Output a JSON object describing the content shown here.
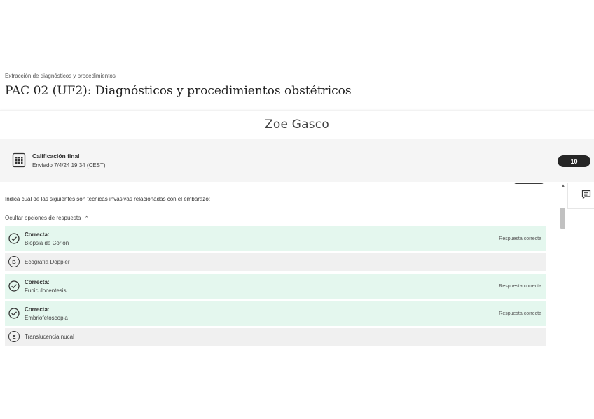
{
  "header": {
    "breadcrumb": "Extracción de diagnósticos y procedimientos",
    "title": "PAC 02 (UF2): Diagnósticos y procedimientos obstétricos"
  },
  "student": {
    "name": "Zoe Gasco"
  },
  "grade": {
    "label": "Calificación final",
    "submitted": "Enviado 7/4/24 19:34 (CEST)",
    "score": "10"
  },
  "question": {
    "text": "Indica cuál de las siguientes son técnicas invasivas relacionadas con el embarazo:",
    "toggle_label": "Ocultar opciones de respuesta",
    "answers": [
      {
        "status": "Correcta:",
        "text": "Biopsia de Corión",
        "note": "Respuesta correcta"
      },
      {
        "letter": "B",
        "text": "Ecografía Doppler"
      },
      {
        "status": "Correcta:",
        "text": "Funiculocentesis",
        "note": "Respuesta correcta"
      },
      {
        "status": "Correcta:",
        "text": "Embriofetoscopia",
        "note": "Respuesta correcta"
      },
      {
        "letter": "E",
        "text": "Translucencia nucal"
      }
    ]
  },
  "icons": {
    "grade": "gradebook-icon",
    "correct": "check-circle-icon",
    "comment": "comment-icon",
    "toggle": "chevron-up-icon"
  },
  "colors": {
    "correct_bg": "#e4f7ee",
    "neutral_bg": "#f0f0f0",
    "score_pill": "#262626"
  }
}
